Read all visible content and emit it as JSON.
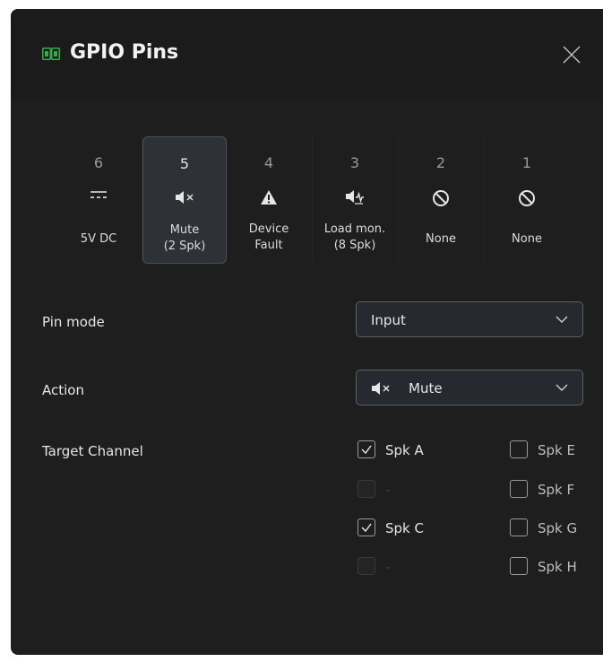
{
  "dialog": {
    "title": "GPIO Pins",
    "close_icon": "close-icon",
    "title_icon": "gpio-connector-icon"
  },
  "pins": [
    {
      "number": "6",
      "icon": "dc-power-icon",
      "label_line1": "5V DC",
      "label_line2": "",
      "selected": false
    },
    {
      "number": "5",
      "icon": "speaker-mute-icon",
      "label_line1": "Mute",
      "label_line2": "(2 Spk)",
      "selected": true
    },
    {
      "number": "4",
      "icon": "warning-icon",
      "label_line1": "Device",
      "label_line2": "Fault",
      "selected": false
    },
    {
      "number": "3",
      "icon": "speaker-monitor-icon",
      "label_line1": "Load mon.",
      "label_line2": "(8 Spk)",
      "selected": false
    },
    {
      "number": "2",
      "icon": "none-icon",
      "label_line1": "None",
      "label_line2": "",
      "selected": false
    },
    {
      "number": "1",
      "icon": "none-icon",
      "label_line1": "None",
      "label_line2": "",
      "selected": false
    }
  ],
  "pin_mode": {
    "label": "Pin mode",
    "value": "Input"
  },
  "action": {
    "label": "Action",
    "value": "Mute",
    "icon": "speaker-mute-icon"
  },
  "target_channel": {
    "label": "Target Channel",
    "channels": [
      {
        "label": "Spk A",
        "checked": true,
        "enabled": true
      },
      {
        "label": "-",
        "checked": false,
        "enabled": false
      },
      {
        "label": "Spk C",
        "checked": true,
        "enabled": true
      },
      {
        "label": "-",
        "checked": false,
        "enabled": false
      },
      {
        "label": "Spk E",
        "checked": false,
        "enabled": true
      },
      {
        "label": "Spk F",
        "checked": false,
        "enabled": true
      },
      {
        "label": "Spk G",
        "checked": false,
        "enabled": true
      },
      {
        "label": "Spk H",
        "checked": false,
        "enabled": true
      }
    ]
  },
  "colors": {
    "background": "#1e1e1e",
    "titlebar": "#1a1b1a",
    "accent_green": "#2fae4a",
    "selected_pin": "#2e3136"
  }
}
